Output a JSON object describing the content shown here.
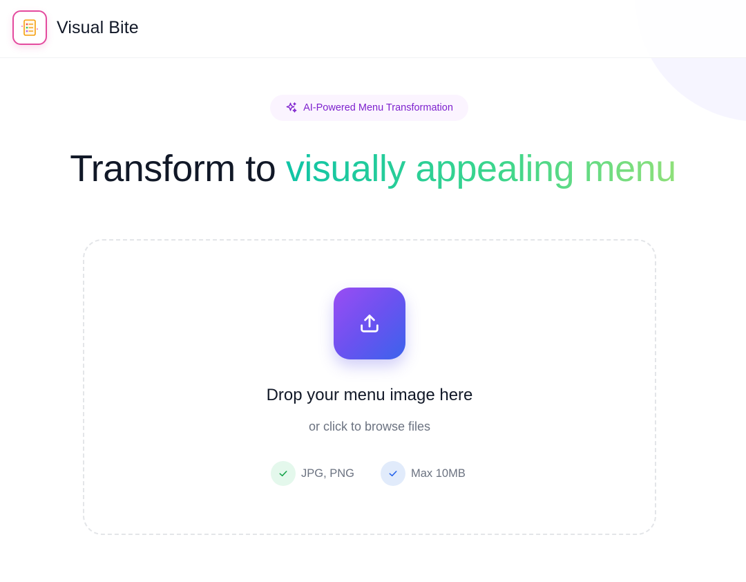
{
  "header": {
    "brand_name": "Visual Bite",
    "logo_icon": "menu-card-icon"
  },
  "badge": {
    "icon": "sparkles-icon",
    "label": "AI-Powered Menu Transformation",
    "color": "#7e22ce"
  },
  "hero": {
    "plain": "Transform to ",
    "highlight": "visually appealing menu"
  },
  "dropzone": {
    "icon": "upload-icon",
    "title": "Drop your menu image here",
    "subtitle": "or click to browse files",
    "chips": [
      {
        "label": "JPG, PNG",
        "icon": "check-icon",
        "color": "#16a34a"
      },
      {
        "label": "Max 10MB",
        "icon": "check-icon",
        "color": "#2563eb"
      }
    ]
  },
  "colors": {
    "accent_gradient_start": "#10c4a6",
    "accent_gradient_end": "#8fe07a",
    "upload_gradient_start": "#9a4df3",
    "upload_gradient_end": "#3b63ec"
  }
}
